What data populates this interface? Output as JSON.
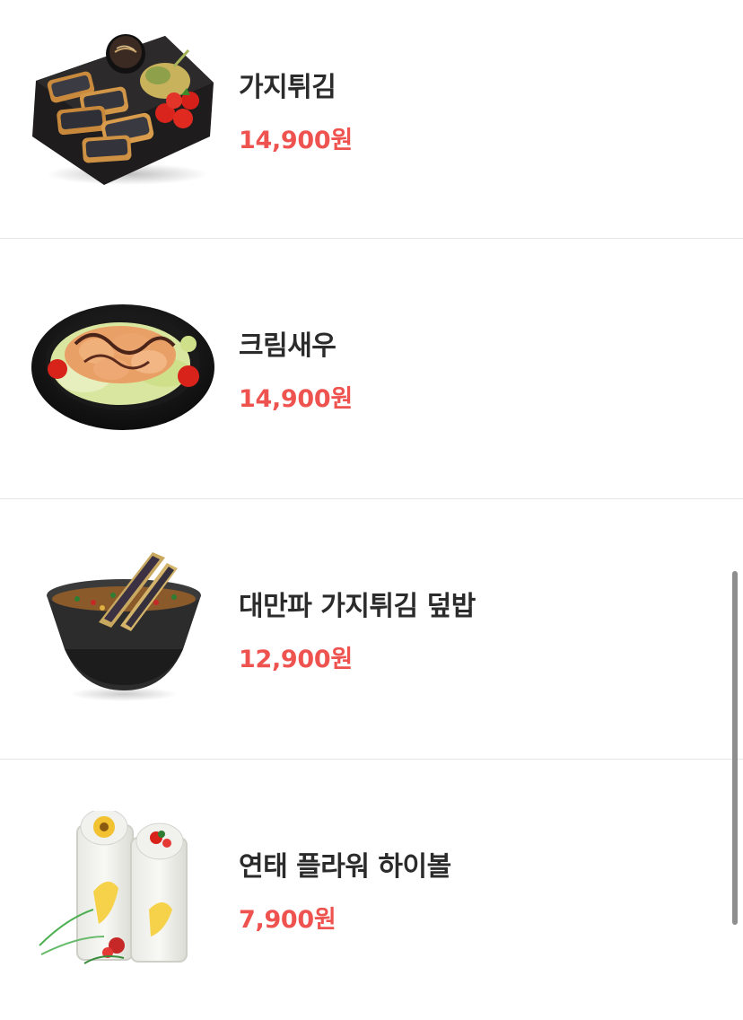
{
  "menu": {
    "items": [
      {
        "name": "가지튀김",
        "price": "14,900원",
        "image_icon": "fried-eggplant-plate"
      },
      {
        "name": "크림새우",
        "price": "14,900원",
        "image_icon": "cream-shrimp-plate"
      },
      {
        "name": "대만파 가지튀김 덮밥",
        "price": "12,900원",
        "image_icon": "eggplant-rice-bowl"
      },
      {
        "name": "연태 플라워 하이볼",
        "price": "7,900원",
        "image_icon": "flower-highball-glasses"
      }
    ]
  },
  "colors": {
    "price": "#ef5350",
    "name": "#2b2b2b",
    "divider": "#e6e6e6",
    "scrollbar": "#8e8e8e"
  }
}
